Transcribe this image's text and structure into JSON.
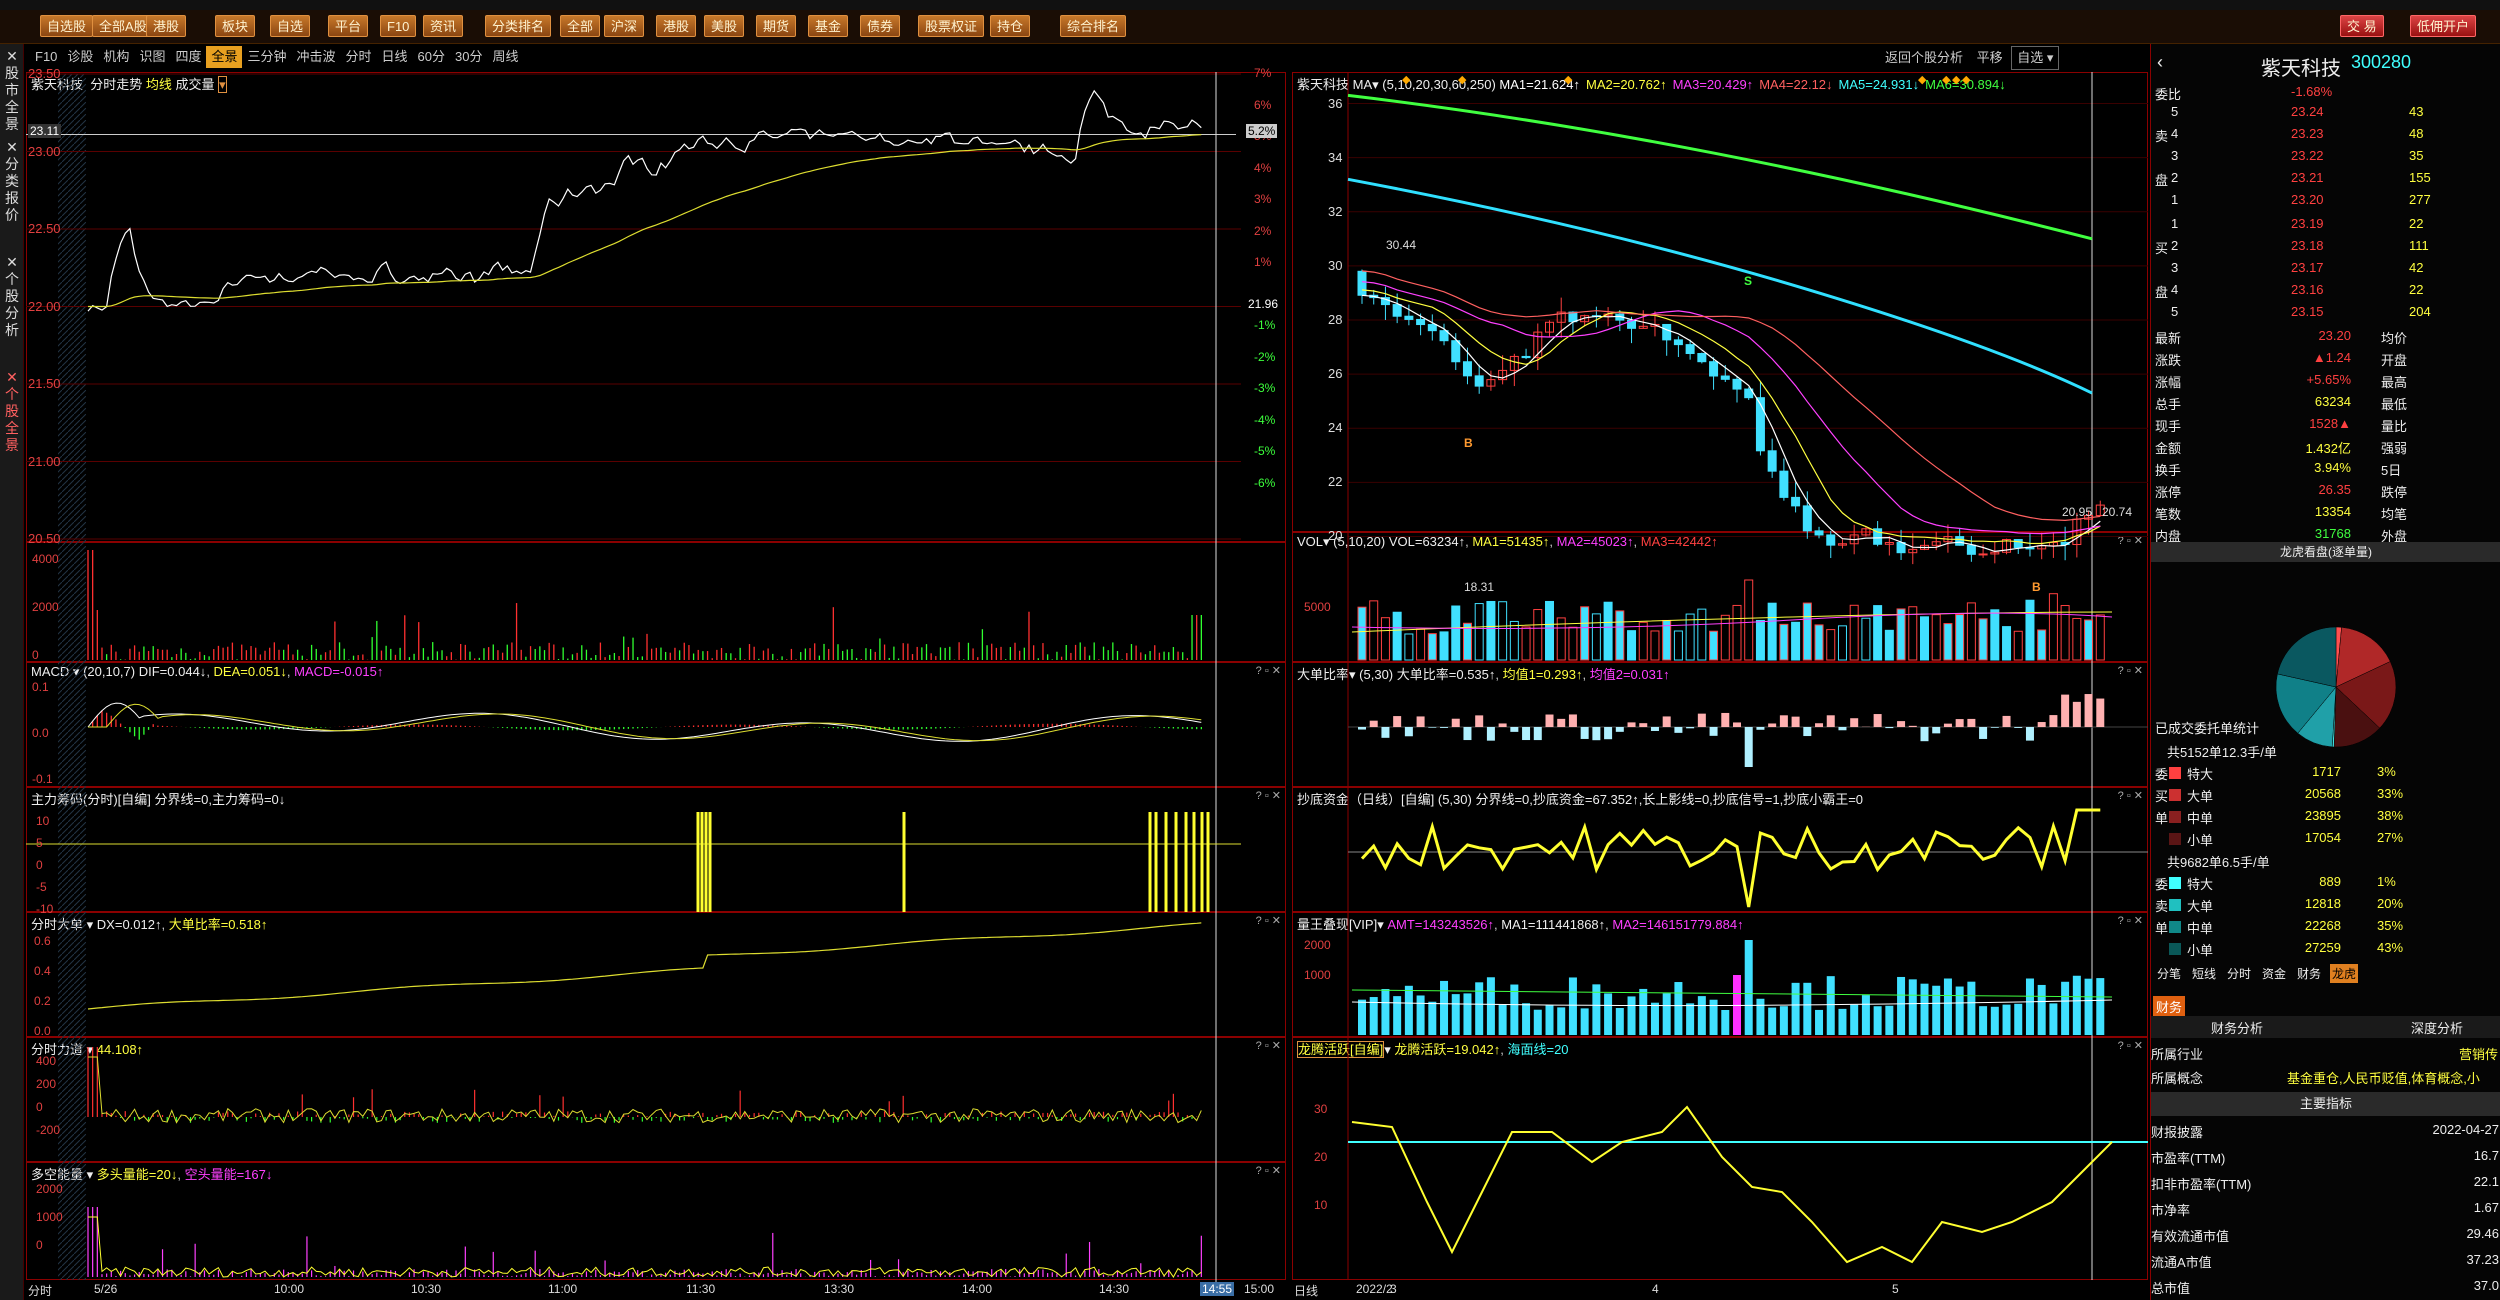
{
  "toolbar": {
    "buttons": [
      "自选股",
      "全部A股",
      "港股",
      "板块",
      "自选",
      "平台",
      "F10",
      "资讯",
      "分类排名",
      "全部",
      "沪深",
      "港股",
      "美股",
      "期货",
      "基金",
      "债券",
      "股票权证",
      "持仓",
      "综合排名"
    ],
    "trade": "交 易",
    "account": "低佣开户"
  },
  "sidebar": {
    "tabs": [
      "股市全景",
      "分类报价",
      "个股分析",
      "个股全景"
    ]
  },
  "subbar": {
    "items": [
      "F10",
      "诊股",
      "机构",
      "识图",
      "四度",
      "全景",
      "三分钟",
      "冲击波",
      "分时",
      "日线",
      "60分",
      "30分",
      "周线"
    ],
    "active": "全景"
  },
  "rightbar": {
    "items": [
      "返回个股分析",
      "平移",
      "自选"
    ]
  },
  "left": {
    "title": "紫天科技",
    "subtitle": "分时走势",
    "avg": "均线",
    "vol": "成交量",
    "price_marker": "23.11",
    "pct_marker": "5.2%",
    "mid_label": "21.96",
    "price_ticks": [
      "23.50",
      "23.00",
      "22.50",
      "22.00",
      "21.50",
      "21.00",
      "20.50"
    ],
    "pct_ticks": [
      "7%",
      "6%",
      "5%",
      "4%",
      "3%",
      "2%",
      "1%",
      "-1%",
      "-2%",
      "-3%",
      "-4%",
      "-5%",
      "-6%"
    ],
    "vol_ticks": [
      "4000",
      "2000",
      "0"
    ],
    "macd": {
      "name": "MACD",
      "params": "(20,10,7)",
      "dif": "DIF=0.044↓",
      "dea": "DEA=0.051↓",
      "macd": "MACD=-0.015↑",
      "ticks": [
        "0.1",
        "0.0",
        "-0.1"
      ]
    },
    "zl": {
      "name": "主力筹码(分时)[自编]",
      "txt": "分界线=0,主力筹码=0↓",
      "ticks": [
        "10",
        "5",
        "0",
        "-5",
        "-10"
      ]
    },
    "dd": {
      "name": "分时大单",
      "txt": "DX=0.012↑",
      "txt2": "大单比率=0.518↑",
      "ticks": [
        "0.6",
        "0.4",
        "0.2",
        "0.0"
      ]
    },
    "fl": {
      "name": "分时力道",
      "txt": "44.108↑",
      "ticks": [
        "400",
        "200",
        "0",
        "-200"
      ]
    },
    "dk": {
      "name": "多空能量",
      "txt": "多头量能=20↓",
      "txt2": "空头量能=167↓",
      "ticks": [
        "2000",
        "1000",
        "0"
      ]
    },
    "time": [
      "分时",
      "5/26",
      "10:00",
      "10:30",
      "11:00",
      "11:30",
      "13:30",
      "14:00",
      "14:30",
      "14:55",
      "15:00"
    ]
  },
  "mid": {
    "title": "紫天科技",
    "ma": "MA",
    "params": "(5,10,20,30,60,250)",
    "ma_vals": [
      {
        "t": "MA1=21.624↑",
        "c": "#ffffff"
      },
      {
        "t": "MA2=20.762↑",
        "c": "#ffff40"
      },
      {
        "t": "MA3=20.429↑",
        "c": "#ff40ff"
      },
      {
        "t": "MA4=22.12↓",
        "c": "#ff6060"
      },
      {
        "t": "MA5=24.931↓",
        "c": "#40ffff"
      },
      {
        "t": "MA6=30.894↓",
        "c": "#40ff40"
      }
    ],
    "price_ticks": [
      "36",
      "34",
      "32",
      "30",
      "28",
      "26",
      "24",
      "22",
      "20"
    ],
    "hi": "30.44",
    "lo": "18.31",
    "cur": "20.95",
    "cur2": "20.74",
    "buy": "B",
    "sell": "S",
    "vol": {
      "name": "VOL",
      "params": "(5,10,20)",
      "txt": "VOL=63234↑",
      "ma1": "MA1=51435↑",
      "ma2": "MA2=45023↑",
      "ma3": "MA3=42442↑",
      "ticks": [
        "5000"
      ]
    },
    "ddb": {
      "name": "大单比率",
      "params": "(5,30)",
      "txt": "大单比率=0.535↑",
      "j1": "均值1=0.293↑",
      "j2": "均值2=0.031↑"
    },
    "cd": {
      "name": "抄底资金（日线）[自编]",
      "params": "(5,30)",
      "txt": "分界线=0,抄底资金=67.352↑,长上影线=0,抄底信号=1,抄底小霸王=0"
    },
    "lw": {
      "name": "量王叠现[VIP]",
      "amt": "AMT=143243526↑",
      "ma1": "MA1=111441868↑",
      "ma2": "MA2=146151779.884↑",
      "ticks": [
        "2000",
        "1000"
      ]
    },
    "lt": {
      "name": "龙腾活跃[自编]",
      "txt": "龙腾活跃=19.042↑",
      "hy": "海面线=20",
      "ticks": [
        "30",
        "20",
        "10"
      ]
    },
    "time": [
      "日线",
      "2022/2",
      "3",
      "4",
      "5"
    ]
  },
  "right": {
    "name": "紫天科技",
    "code": "300280",
    "weibi": {
      "label": "委比",
      "val": "-1.68%"
    },
    "sell": [
      {
        "l": "5",
        "p": "23.24",
        "v": "43"
      },
      {
        "l": "4",
        "p": "23.23",
        "v": "48"
      },
      {
        "l": "3",
        "p": "23.22",
        "v": "35"
      },
      {
        "l": "2",
        "p": "23.21",
        "v": "155"
      },
      {
        "l": "1",
        "p": "23.20",
        "v": "277"
      }
    ],
    "buy": [
      {
        "l": "1",
        "p": "23.19",
        "v": "22"
      },
      {
        "l": "2",
        "p": "23.18",
        "v": "111"
      },
      {
        "l": "3",
        "p": "23.17",
        "v": "42"
      },
      {
        "l": "4",
        "p": "23.16",
        "v": "22"
      },
      {
        "l": "5",
        "p": "23.15",
        "v": "204"
      }
    ],
    "sell_label": [
      "卖",
      "盘"
    ],
    "buy_label": [
      "买",
      "盘"
    ],
    "stats": [
      {
        "a": "最新",
        "b": "23.20",
        "c": "均价",
        "ac": "red"
      },
      {
        "a": "涨跌",
        "b": "▲1.24",
        "c": "开盘",
        "ac": "red"
      },
      {
        "a": "涨幅",
        "b": "+5.65%",
        "c": "最高",
        "ac": "red"
      },
      {
        "a": "总手",
        "b": "63234",
        "c": "最低",
        "ac": "yel"
      },
      {
        "a": "现手",
        "b": "1528▲",
        "c": "量比",
        "ac": "red"
      },
      {
        "a": "金额",
        "b": "1.432亿",
        "c": "强弱",
        "ac": "yel"
      },
      {
        "a": "换手",
        "b": "3.94%",
        "c": "5日",
        "ac": "yel"
      },
      {
        "a": "涨停",
        "b": "26.35",
        "c": "跌停",
        "ac": "red"
      },
      {
        "a": "笔数",
        "b": "13354",
        "c": "均笔",
        "ac": "yel"
      },
      {
        "a": "内盘",
        "b": "31768",
        "c": "外盘",
        "ac": "grn"
      }
    ],
    "pie_title": "龙虎看盘(逐单量)",
    "tongji": "已成交委托单统计",
    "buy_sum": "共5152单12.3手/单",
    "buy_rows": [
      {
        "t": "特大",
        "v": "1717",
        "p": "3%",
        "c": "#ff4040"
      },
      {
        "t": "大单",
        "v": "20568",
        "p": "33%",
        "c": "#cc3030"
      },
      {
        "t": "中单",
        "v": "23895",
        "p": "38%",
        "c": "#8a2020"
      },
      {
        "t": "小单",
        "v": "17054",
        "p": "27%",
        "c": "#5a1515"
      }
    ],
    "buy_side": [
      "委",
      "买",
      "单"
    ],
    "sell_sum": "共9682单6.5手/单",
    "sell_rows": [
      {
        "t": "特大",
        "v": "889",
        "p": "1%",
        "c": "#40ffff"
      },
      {
        "t": "大单",
        "v": "12818",
        "p": "20%",
        "c": "#20c0c0"
      },
      {
        "t": "中单",
        "v": "22268",
        "p": "35%",
        "c": "#108888"
      },
      {
        "t": "小单",
        "v": "27259",
        "p": "43%",
        "c": "#0a5858"
      }
    ],
    "sell_side": [
      "委",
      "卖",
      "单"
    ],
    "tabs": [
      "分笔",
      "短线",
      "分时",
      "资金",
      "财务",
      "龙虎"
    ],
    "fin": "财务",
    "fin_tab1": "财务分析",
    "fin_tab2": "深度分析",
    "industry": {
      "l": "所属行业",
      "v": "营销传"
    },
    "concept": {
      "l": "所属概念",
      "v": "基金重仓,人民币贬值,体育概念,小"
    },
    "main_idx": "主要指标",
    "fin_rows": [
      {
        "l": "财报披露",
        "v": "2022-04-27"
      },
      {
        "l": "市盈率(TTM)",
        "v": "16.7"
      },
      {
        "l": "扣非市盈率(TTM)",
        "v": "22.1"
      },
      {
        "l": "市净率",
        "v": "1.67"
      },
      {
        "l": "有效流通市值",
        "v": "29.46"
      },
      {
        "l": "流通A市值",
        "v": "37.23"
      },
      {
        "l": "总市值",
        "v": "37.0"
      }
    ]
  }
}
